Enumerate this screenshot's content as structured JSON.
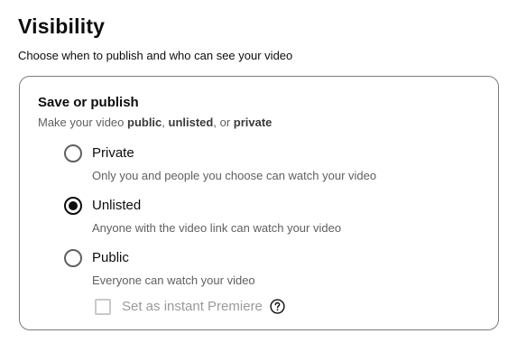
{
  "header": {
    "title": "Visibility",
    "subtitle": "Choose when to publish and who can see your video"
  },
  "card": {
    "title": "Save or publish",
    "subtitle_prefix": "Make your video ",
    "subtitle_public": "public",
    "subtitle_sep1": ", ",
    "subtitle_unlisted": "unlisted",
    "subtitle_sep2": ", or ",
    "subtitle_private": "private"
  },
  "options": [
    {
      "label": "Private",
      "description": "Only you and people you choose can watch your video",
      "selected": false
    },
    {
      "label": "Unlisted",
      "description": "Anyone with the video link can watch your video",
      "selected": true
    },
    {
      "label": "Public",
      "description": "Everyone can watch your video",
      "selected": false
    }
  ],
  "premiere": {
    "label": "Set as instant Premiere",
    "checked": false,
    "disabled": true,
    "help_icon": "help-circle-icon"
  },
  "colors": {
    "text_primary": "#0d0d0d",
    "text_secondary": "#606060",
    "disabled": "#9a9a9a"
  }
}
